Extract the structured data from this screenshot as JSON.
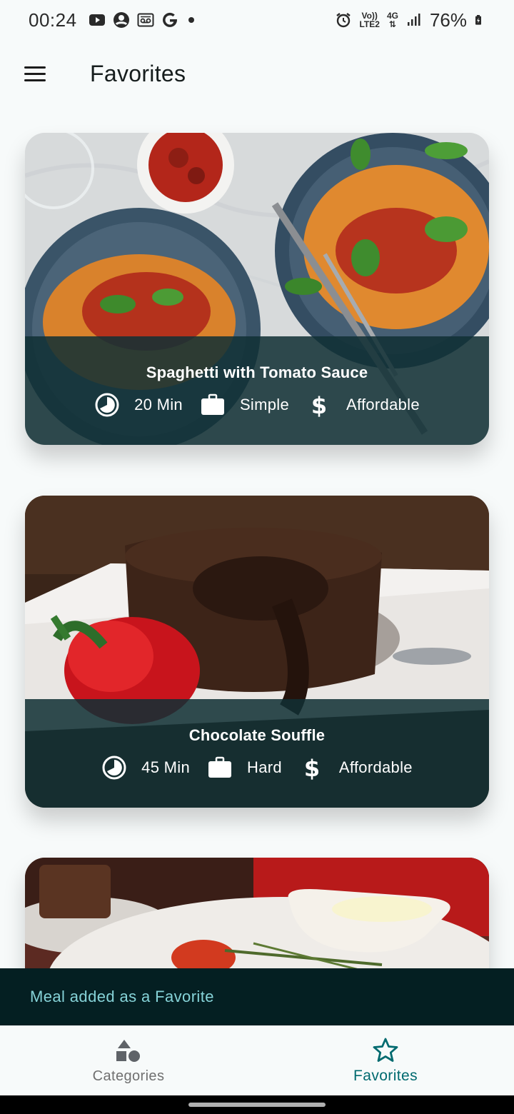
{
  "status_bar": {
    "time": "00:24",
    "network_top": "Vo))",
    "network_bottom": "LTE2",
    "data_type": "4G",
    "battery": "76%"
  },
  "app_bar": {
    "title": "Favorites"
  },
  "meals": [
    {
      "title": "Spaghetti with Tomato Sauce",
      "duration": "20 Min",
      "complexity": "Simple",
      "affordability": "Affordable"
    },
    {
      "title": "Chocolate Souffle",
      "duration": "45 Min",
      "complexity": "Hard",
      "affordability": "Affordable"
    },
    {
      "title": "",
      "duration": "",
      "complexity": "",
      "affordability": ""
    }
  ],
  "snackbar": {
    "message": "Meal added as a Favorite"
  },
  "bottom_nav": {
    "items": [
      {
        "label": "Categories",
        "icon": "categories-icon",
        "active": false
      },
      {
        "label": "Favorites",
        "icon": "star-icon",
        "active": true
      }
    ]
  },
  "colors": {
    "accent": "#006a6f",
    "overlay": "#10303a",
    "snackbar_bg": "#041f22",
    "snackbar_text": "#86d3d8"
  }
}
